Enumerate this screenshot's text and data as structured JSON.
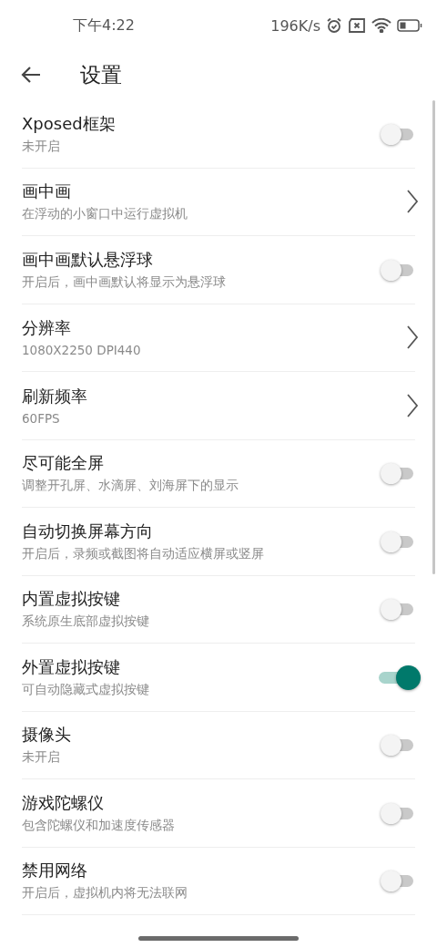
{
  "status_bar": {
    "time": "下午4:22",
    "speed": "196K/s"
  },
  "header": {
    "title": "设置"
  },
  "settings": [
    {
      "kind": "switch",
      "title": "Xposed框架",
      "subtitle": "未开启",
      "on": false
    },
    {
      "kind": "link",
      "title": "画中画",
      "subtitle": "在浮动的小窗口中运行虚拟机"
    },
    {
      "kind": "switch",
      "title": "画中画默认悬浮球",
      "subtitle": "开启后，画中画默认将显示为悬浮球",
      "on": false
    },
    {
      "kind": "link",
      "title": "分辨率",
      "subtitle": "1080X2250 DPI440"
    },
    {
      "kind": "link",
      "title": "刷新频率",
      "subtitle": "60FPS"
    },
    {
      "kind": "switch",
      "title": "尽可能全屏",
      "subtitle": "调整开孔屏、水滴屏、刘海屏下的显示",
      "on": false
    },
    {
      "kind": "switch",
      "title": "自动切换屏幕方向",
      "subtitle": "开启后，录频或截图将自动适应横屏或竖屏",
      "on": false
    },
    {
      "kind": "switch",
      "title": "内置虚拟按键",
      "subtitle": "系统原生底部虚拟按键",
      "on": false
    },
    {
      "kind": "switch",
      "title": "外置虚拟按键",
      "subtitle": "可自动隐藏式虚拟按键",
      "on": true
    },
    {
      "kind": "switch",
      "title": "摄像头",
      "subtitle": "未开启",
      "on": false
    },
    {
      "kind": "switch",
      "title": "游戏陀螺仪",
      "subtitle": "包含陀螺仪和加速度传感器",
      "on": false
    },
    {
      "kind": "switch",
      "title": "禁用网络",
      "subtitle": "开启后，虚拟机内将无法联网",
      "on": false
    }
  ]
}
